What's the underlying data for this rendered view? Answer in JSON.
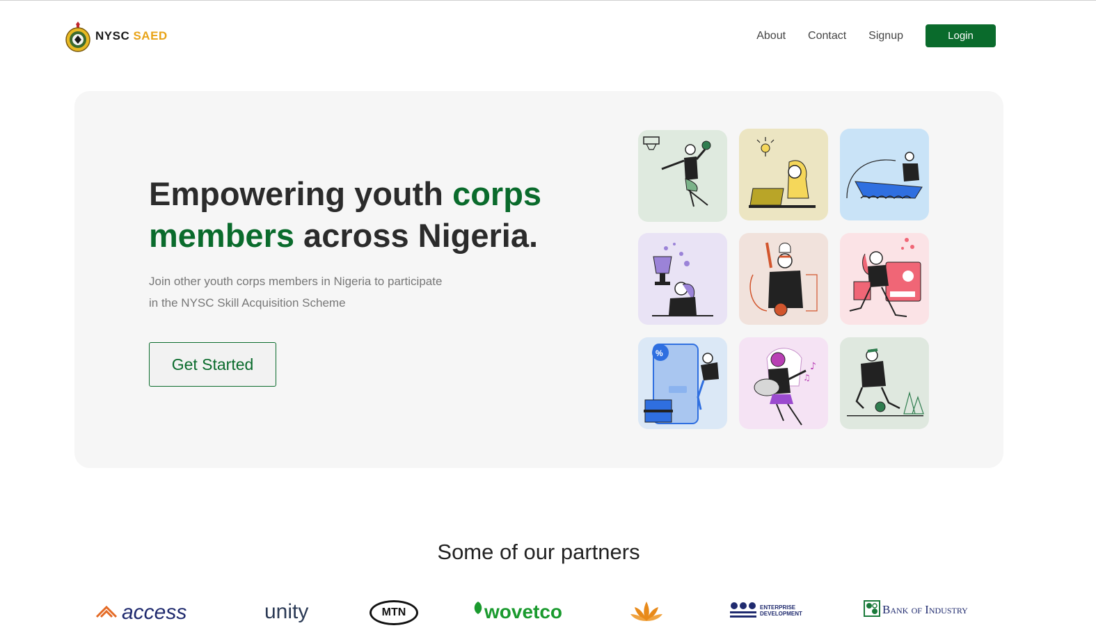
{
  "brand": {
    "name_part1": "NYSC",
    "name_part2": "SAED"
  },
  "nav": {
    "about": "About",
    "contact": "Contact",
    "signup": "Signup",
    "login": "Login"
  },
  "hero": {
    "title_part1": "Empowering youth ",
    "title_highlight1": "corps",
    "title_highlight2": "members",
    "title_part2": " across Nigeria.",
    "description_line1": "Join other youth corps members in Nigeria to participate",
    "description_line2": "in the NYSC Skill Acquisition Scheme",
    "cta": "Get Started"
  },
  "illustrations": [
    {
      "name": "basketball-player-illustration",
      "bg": "#dfeadf"
    },
    {
      "name": "idea-laptop-illustration",
      "bg": "#ece5c2"
    },
    {
      "name": "fishing-boat-illustration",
      "bg": "#c9e3f7"
    },
    {
      "name": "trophy-winner-illustration",
      "bg": "#e9e3f5"
    },
    {
      "name": "chef-cooking-illustration",
      "bg": "#f1e2dc"
    },
    {
      "name": "shopping-analytics-illustration",
      "bg": "#fbe3e6"
    },
    {
      "name": "online-shopping-illustration",
      "bg": "#dbe8f6"
    },
    {
      "name": "guitar-music-illustration",
      "bg": "#f5e3f4"
    },
    {
      "name": "football-player-illustration",
      "bg": "#dfe8df"
    }
  ],
  "partners": {
    "title": "Some of our partners",
    "logos": {
      "access": "access",
      "unity": "unity",
      "mtn": "MTN",
      "wovetco": "wovetco",
      "enterprise_line1": "ENTERPRISE",
      "enterprise_line2": "DEVELOPMENT",
      "boi": "Bank of Industry"
    }
  },
  "colors": {
    "brand_green": "#0a6b2c",
    "brand_gold": "#e8a317"
  }
}
